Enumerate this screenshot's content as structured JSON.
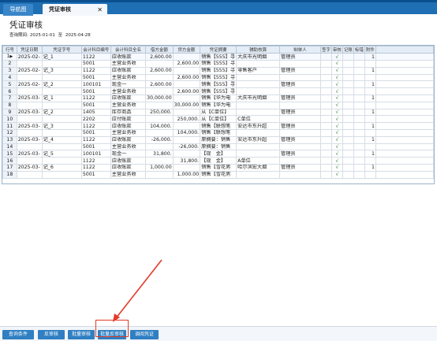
{
  "tabs": [
    {
      "label": "导航图"
    },
    {
      "label": "凭证审核",
      "close": "✕"
    }
  ],
  "page_title": "凭证审核",
  "query": {
    "label": "查询期间:",
    "from": "2025-01-01",
    "sep": "至",
    "to": "2025-04-28"
  },
  "columns": [
    "行号",
    "凭证日期",
    "凭证字号",
    "会计科目编号",
    "会计科目全名",
    "借方金额",
    "贷方金额",
    "凭证摘要",
    "辅助核算",
    "制单人",
    "签字",
    "审核",
    "记账",
    "标错",
    "附件"
  ],
  "rows": [
    {
      "n": "1",
      "date": "2025-02-",
      "voucher": "记_1",
      "code": "1122",
      "name": "应收账款",
      "debit": "2,600.00",
      "credit": "",
      "memo": "销售【555】寻",
      "aux": "大庆市光明烟",
      "maker": "管理员",
      "audit": "√",
      "attach": "1",
      "selected": true
    },
    {
      "n": "2",
      "date": "",
      "voucher": "",
      "code": "5001",
      "name": "主营业务收",
      "debit": "",
      "credit": "2,600.00",
      "memo": "销售【555】寻",
      "aux": "",
      "maker": "",
      "audit": "√",
      "attach": ""
    },
    {
      "n": "3",
      "date": "2025-02-",
      "voucher": "记_3",
      "code": "1122",
      "name": "应收账款",
      "debit": "2,600.00",
      "credit": "",
      "memo": "销售【555】寻",
      "aux": "零售客户",
      "maker": "管理员",
      "audit": "√",
      "attach": "1"
    },
    {
      "n": "4",
      "date": "",
      "voucher": "",
      "code": "5001",
      "name": "主营业务收",
      "debit": "",
      "credit": "2,600.00",
      "memo": "销售【555】寻",
      "aux": "",
      "maker": "",
      "audit": "√",
      "attach": ""
    },
    {
      "n": "5",
      "date": "2025-02-",
      "voucher": "记_2",
      "code": "100101",
      "name": "现金一",
      "debit": "2,600.00",
      "credit": "",
      "memo": "销售【555】寻",
      "aux": "",
      "maker": "管理员",
      "audit": "√",
      "attach": "1"
    },
    {
      "n": "6",
      "date": "",
      "voucher": "",
      "code": "5001",
      "name": "主营业务收",
      "debit": "",
      "credit": "2,600.00",
      "memo": "销售【555】寻",
      "aux": "",
      "maker": "",
      "audit": "√",
      "attach": ""
    },
    {
      "n": "7",
      "date": "2025-03-",
      "voucher": "记_1",
      "code": "1122",
      "name": "应收账款",
      "debit": "30,000.00",
      "credit": "",
      "memo": "销售【华为电",
      "aux": "大庆市光明烟",
      "maker": "管理员",
      "audit": "√",
      "attach": "1"
    },
    {
      "n": "8",
      "date": "",
      "voucher": "",
      "code": "5001",
      "name": "主营业务收",
      "debit": "",
      "credit": "30,000.00",
      "memo": "销售【华为电",
      "aux": "",
      "maker": "",
      "audit": "√",
      "attach": ""
    },
    {
      "n": "9",
      "date": "2025-03-",
      "voucher": "记_2",
      "code": "1405",
      "name": "库存商品",
      "debit": "250,000.",
      "credit": "",
      "memo": "从【C单位】",
      "aux": "",
      "maker": "管理员",
      "audit": "√",
      "attach": "1"
    },
    {
      "n": "10",
      "date": "",
      "voucher": "",
      "code": "2202",
      "name": "应付账款",
      "debit": "",
      "credit": "250,000.",
      "memo": "从【C单位】",
      "aux": "C单位",
      "maker": "",
      "audit": "√",
      "attach": ""
    },
    {
      "n": "11",
      "date": "2025-03-",
      "voucher": "记_3",
      "code": "1122",
      "name": "应收账款",
      "debit": "104,000.",
      "credit": "",
      "memo": "销售【联想笔",
      "aux": "安达市东升超",
      "maker": "管理员",
      "audit": "√",
      "attach": "1"
    },
    {
      "n": "12",
      "date": "",
      "voucher": "",
      "code": "5001",
      "name": "主营业务收",
      "debit": "",
      "credit": "104,000.",
      "memo": "销售【联想笔",
      "aux": "",
      "maker": "",
      "audit": "√",
      "attach": ""
    },
    {
      "n": "13",
      "date": "2025-03-",
      "voucher": "记_4",
      "code": "1122",
      "name": "应收账款",
      "debit": "-26,000.",
      "credit": "",
      "memo": "原摘要：销售",
      "aux": "安达市东升超",
      "maker": "管理员",
      "audit": "√",
      "attach": "1"
    },
    {
      "n": "14",
      "date": "",
      "voucher": "",
      "code": "5001",
      "name": "主营业务收",
      "debit": "",
      "credit": "-26,000.",
      "memo": "原摘要：销售",
      "aux": "",
      "maker": "",
      "audit": "√",
      "attach": ""
    },
    {
      "n": "15",
      "date": "2025-03-",
      "voucher": "记_5",
      "code": "100101",
      "name": "现金一",
      "debit": "31,800.",
      "credit": "",
      "memo": "【现　金】",
      "aux": "",
      "maker": "管理员",
      "audit": "√",
      "attach": "1"
    },
    {
      "n": "16",
      "date": "",
      "voucher": "",
      "code": "1122",
      "name": "应收账款",
      "debit": "",
      "credit": "31,800.",
      "memo": "【现　金】",
      "aux": "A单位",
      "maker": "",
      "audit": "√",
      "attach": ""
    },
    {
      "n": "17",
      "date": "2025-03-",
      "voucher": "记_6",
      "code": "1122",
      "name": "应收账款",
      "debit": "1,000.00",
      "credit": "",
      "memo": "销售【雪花男",
      "aux": "哈尔滨宏大烟",
      "maker": "管理员",
      "audit": "√",
      "attach": "1"
    },
    {
      "n": "18",
      "date": "",
      "voucher": "",
      "code": "5001",
      "name": "主营业务收",
      "debit": "",
      "credit": "1,000.00",
      "memo": "销售【雪花男",
      "aux": "",
      "maker": "",
      "audit": "√",
      "attach": ""
    }
  ],
  "buttons": [
    {
      "label": "查询条件"
    },
    {
      "label": "反审核"
    },
    {
      "label": "批量审核"
    },
    {
      "label": "批量反审核"
    },
    {
      "label": "调阅凭证"
    }
  ],
  "colors": {
    "tabbar": "#1f6fb5",
    "button": "#2f7fc2",
    "highlight": "#e23b2a"
  }
}
